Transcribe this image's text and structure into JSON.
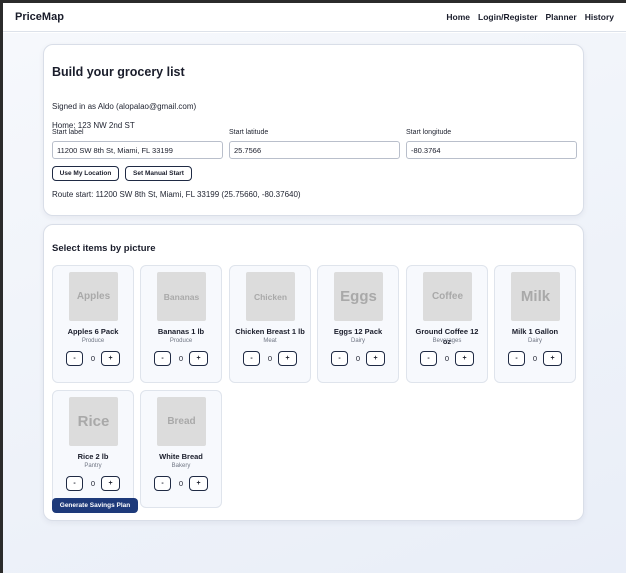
{
  "nav": {
    "brand": "PriceMap",
    "links": [
      "Home",
      "Login/Register",
      "Planner",
      "History"
    ]
  },
  "builder": {
    "title": "Build your grocery list",
    "signed_in": "Signed in as Aldo (alopalao@gmail.com)",
    "home": "Home: 123 NW 2nd ST",
    "start_label_label": "Start label",
    "start_label_value": "11200 SW 8th St, Miami, FL 33199",
    "start_lat_label": "Start latitude",
    "start_lat_value": "25.7566",
    "start_lng_label": "Start longitude",
    "start_lng_value": "-80.3764",
    "use_location_label": "Use My Location",
    "manual_start_label": "Set Manual Start",
    "route_start": "Route start: 11200 SW 8th St, Miami, FL 33199 (25.75660, -80.37640)"
  },
  "items_section": {
    "title": "Select items by picture",
    "minus_label": "-",
    "plus_label": "+",
    "items": [
      {
        "name": "Apples 6 Pack",
        "category": "Produce",
        "thumb": "Apples",
        "qty": "0"
      },
      {
        "name": "Bananas 1 lb",
        "category": "Produce",
        "thumb": "Bananas",
        "qty": "0"
      },
      {
        "name": "Chicken Breast 1 lb",
        "category": "Meat",
        "thumb": "Chicken",
        "qty": "0"
      },
      {
        "name": "Eggs 12 Pack",
        "category": "Dairy",
        "thumb": "Eggs",
        "qty": "0"
      },
      {
        "name": "Ground Coffee 12 oz",
        "category": "Beverages",
        "thumb": "Coffee",
        "qty": "0"
      },
      {
        "name": "Milk 1 Gallon",
        "category": "Dairy",
        "thumb": "Milk",
        "qty": "0"
      },
      {
        "name": "Rice 2 lb",
        "category": "Pantry",
        "thumb": "Rice",
        "qty": "0"
      },
      {
        "name": "White Bread",
        "category": "Bakery",
        "thumb": "Bread",
        "qty": "0"
      }
    ],
    "generate_label": "Generate Savings Plan"
  }
}
